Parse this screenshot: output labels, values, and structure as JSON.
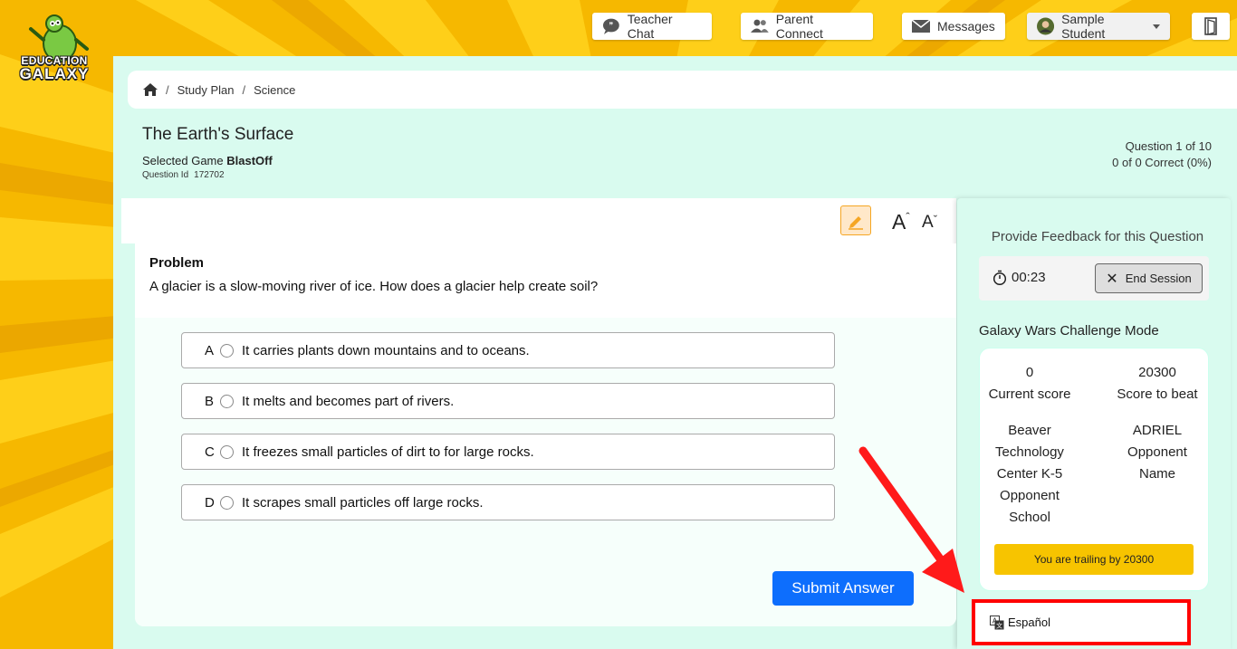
{
  "logo": {
    "line1": "EDUCATION",
    "line2": "GALAXY"
  },
  "topnav": {
    "teacher_chat": "Teacher Chat",
    "parent_connect": "Parent Connect",
    "messages": "Messages",
    "student": "Sample Student"
  },
  "breadcrumb": {
    "items": [
      "Study Plan",
      "Science"
    ]
  },
  "header": {
    "title": "The Earth's Surface",
    "selected_game_label": "Selected Game",
    "selected_game": "BlastOff",
    "question_id_label": "Question Id",
    "question_id": "172702",
    "question_progress": "Question 1 of 10",
    "correct_count": "0 of 0 Correct (0%)"
  },
  "question": {
    "label": "Problem",
    "text": "A glacier is a slow-moving river of ice. How does a glacier help create soil?",
    "answers": [
      {
        "letter": "A",
        "text": "It carries plants down mountains and to oceans."
      },
      {
        "letter": "B",
        "text": "It melts and becomes part of rivers."
      },
      {
        "letter": "C",
        "text": "It freezes small particles of dirt to for large rocks."
      },
      {
        "letter": "D",
        "text": "It scrapes small particles off large rocks."
      }
    ],
    "submit_label": "Submit Answer"
  },
  "tools": {
    "font_increase": "A",
    "font_decrease": "A"
  },
  "sidebar": {
    "feedback_title": "Provide Feedback for this Question",
    "timer": "00:23",
    "end_session_label": "End Session",
    "mode_title": "Galaxy Wars Challenge Mode",
    "current_score_value": "0",
    "current_score_label": "Current score",
    "score_to_beat_value": "20300",
    "score_to_beat_label": "Score to beat",
    "opponent_school": "Beaver Technology Center K-5",
    "opponent_school_label": "Opponent School",
    "opponent_name": "ADRIEL",
    "opponent_name_label": "Opponent Name",
    "trailing_message": "You are trailing by 20300",
    "language_label": "Español"
  },
  "colors": {
    "primary_button": "#0d6efd",
    "panel_background": "#d9fbef",
    "highlight_border": "#ff0000",
    "trailing_banner": "#f7c400"
  }
}
